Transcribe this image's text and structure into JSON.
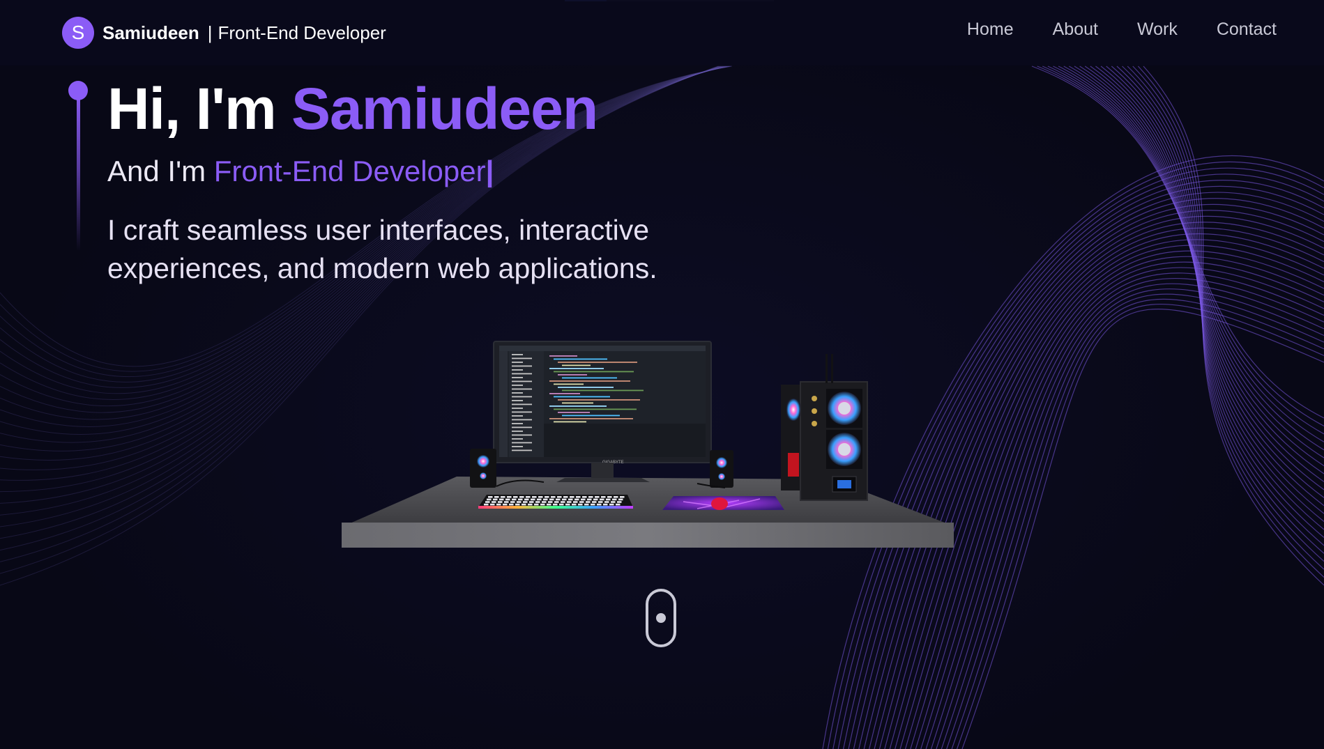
{
  "brand": {
    "logo_letter": "S",
    "name": "Samiudeen",
    "separator": "|",
    "role": "Front-End Developer"
  },
  "nav": {
    "items": [
      {
        "label": "Home"
      },
      {
        "label": "About"
      },
      {
        "label": "Work"
      },
      {
        "label": "Contact"
      }
    ]
  },
  "hero": {
    "greeting": "Hi, I'm ",
    "name": "Samiudeen",
    "subtitle_prefix": "And I'm ",
    "subtitle_role": "Front-End Developer",
    "cursor": "|",
    "description": "I craft seamless user interfaces, interactive experiences, and modern web applications."
  },
  "scene": {
    "monitor_brand": "GIGABYTE"
  },
  "colors": {
    "accent": "#8b5cf6",
    "background": "#080816",
    "text": "#ffffff",
    "nav_text": "#c9c9d6"
  },
  "icons": {
    "scroll": "mouse-scroll-icon"
  }
}
